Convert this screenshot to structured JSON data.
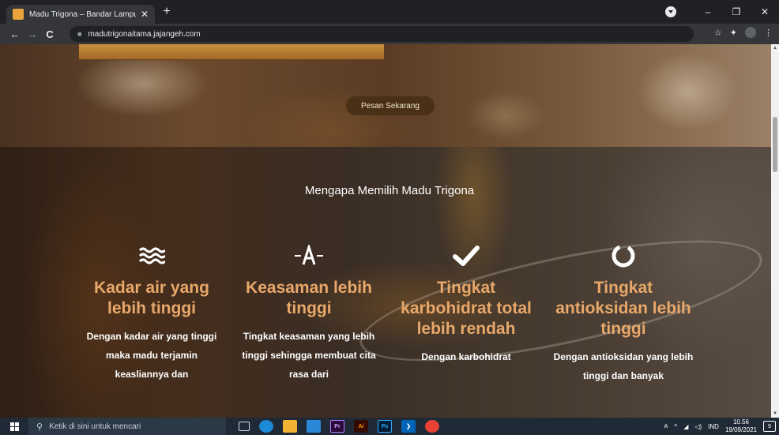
{
  "browser": {
    "tab_title": "Madu Trigona – Bandar Lampung",
    "tab_close": "✕",
    "new_tab": "+",
    "url": "madutrigonaitama.jajangeh.com",
    "window_controls": [
      "–",
      "❐",
      "✕"
    ],
    "nav": {
      "back": "←",
      "forward": "→",
      "reload": "C"
    },
    "extensions": [
      "☆",
      "✦",
      "⋮"
    ]
  },
  "hero": {
    "order_button": "Pesan Sekarang"
  },
  "features": {
    "title": "Mengapa Memilih Madu Trigona",
    "items": [
      {
        "icon": "water-waves-icon",
        "title": "Kadar air yang lebih tinggi",
        "desc": "Dengan kadar air yang tinggi maka madu terjamin keasliannya dan"
      },
      {
        "icon": "acidity-letter-icon",
        "title": "Keasaman lebih tinggi",
        "desc": "Tingkat keasaman yang lebih tinggi sehingga membuat cita rasa dari"
      },
      {
        "icon": "check-icon",
        "title": "Tingkat karbohidrat total lebih rendah",
        "desc": "Dengan karbohidrat"
      },
      {
        "icon": "circle-ring-icon",
        "title": "Tingkat antioksidan lebih tinggi",
        "desc": "Dengan antioksidan yang lebih tinggi dan banyak"
      }
    ]
  },
  "taskbar": {
    "search_placeholder": "Ketik di sini untuk mencari",
    "language": "IND",
    "time": "10.56",
    "date": "19/09/2021",
    "notification_count": "9"
  },
  "colors": {
    "accent_orange": "#e8a86a",
    "button_brown": "#4a3016",
    "taskbar": "#1f2a36"
  }
}
